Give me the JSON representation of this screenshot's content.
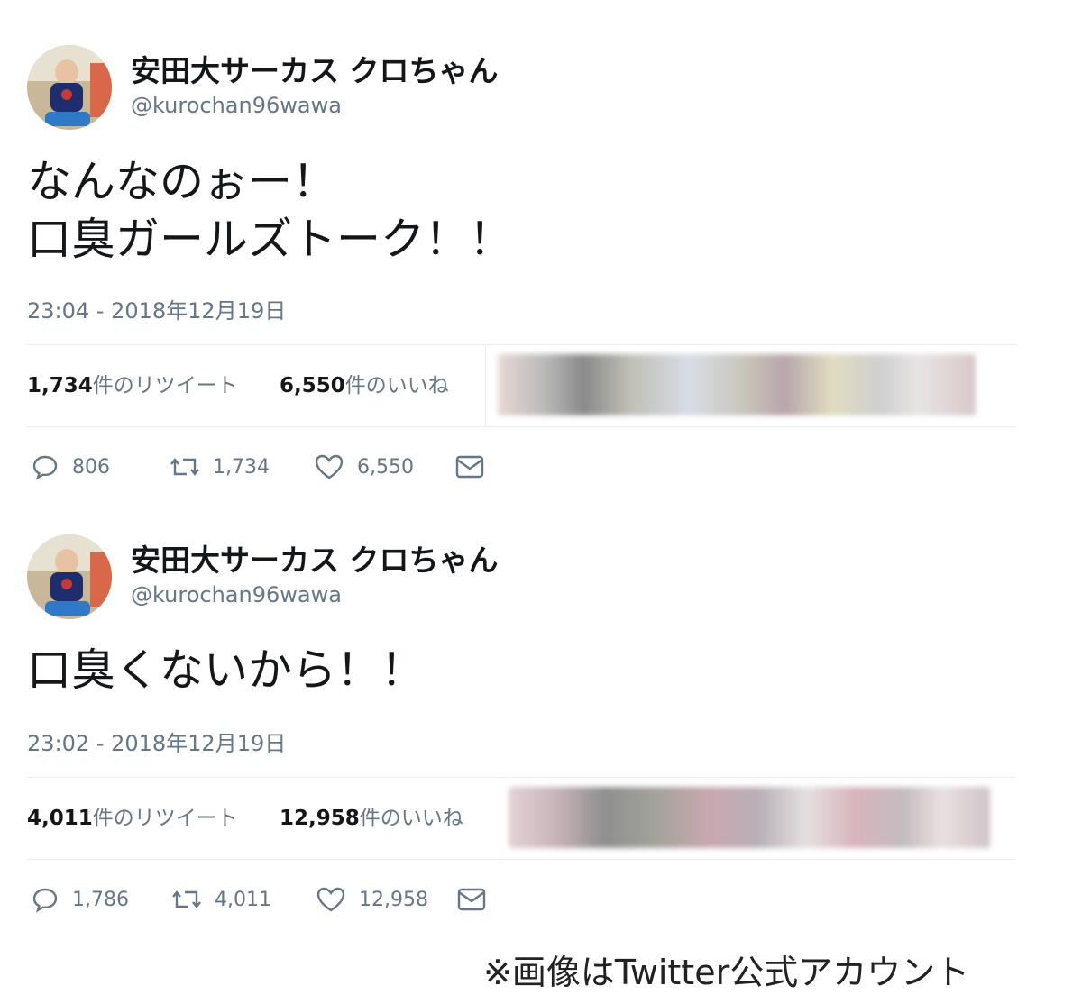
{
  "tweets": [
    {
      "display_name": "安田大サーカス クロちゃん",
      "handle": "@kurochan96wawa",
      "text_lines": [
        "なんなのぉー！",
        "口臭ガールズトーク！！"
      ],
      "timestamp": "23:04 - 2018年12月19日",
      "retweets_count": "1,734",
      "retweets_label": "件のリツイート",
      "likes_count": "6,550",
      "likes_label": "件のいいね",
      "replies": "806",
      "retweets": "1,734",
      "likes": "6,550"
    },
    {
      "display_name": "安田大サーカス クロちゃん",
      "handle": "@kurochan96wawa",
      "text_lines": [
        "口臭くないから！！"
      ],
      "timestamp": "23:02 - 2018年12月19日",
      "retweets_count": "4,011",
      "retweets_label": "件のリツイート",
      "likes_count": "12,958",
      "likes_label": "件のいいね",
      "replies": "1,786",
      "retweets": "4,011",
      "likes": "12,958"
    }
  ],
  "icons": {
    "reply": "reply-icon",
    "retweet": "retweet-icon",
    "like": "heart-icon",
    "dm": "mail-icon"
  },
  "colors": {
    "text_primary": "#14171a",
    "text_secondary": "#657786",
    "divider": "#e6ecf0"
  },
  "caption": "※画像はTwitter公式アカウント"
}
